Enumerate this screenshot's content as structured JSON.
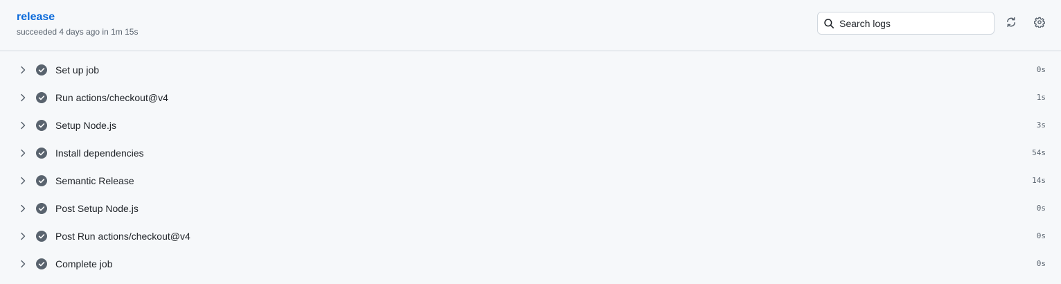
{
  "job": {
    "title": "release",
    "status": "succeeded 4 days ago in 1m 15s"
  },
  "search": {
    "placeholder": "Search logs",
    "value": ""
  },
  "toolbar": {
    "refresh_icon": "sync-icon",
    "settings_icon": "gear-icon"
  },
  "colors": {
    "link": "#0969da",
    "success_check": "#59636e",
    "background": "#f6f8fa"
  },
  "steps": [
    {
      "name": "Set up job",
      "duration": "0s",
      "status": "success"
    },
    {
      "name": "Run actions/checkout@v4",
      "duration": "1s",
      "status": "success"
    },
    {
      "name": "Setup Node.js",
      "duration": "3s",
      "status": "success"
    },
    {
      "name": "Install dependencies",
      "duration": "54s",
      "status": "success"
    },
    {
      "name": "Semantic Release",
      "duration": "14s",
      "status": "success"
    },
    {
      "name": "Post Setup Node.js",
      "duration": "0s",
      "status": "success"
    },
    {
      "name": "Post Run actions/checkout@v4",
      "duration": "0s",
      "status": "success"
    },
    {
      "name": "Complete job",
      "duration": "0s",
      "status": "success"
    }
  ]
}
